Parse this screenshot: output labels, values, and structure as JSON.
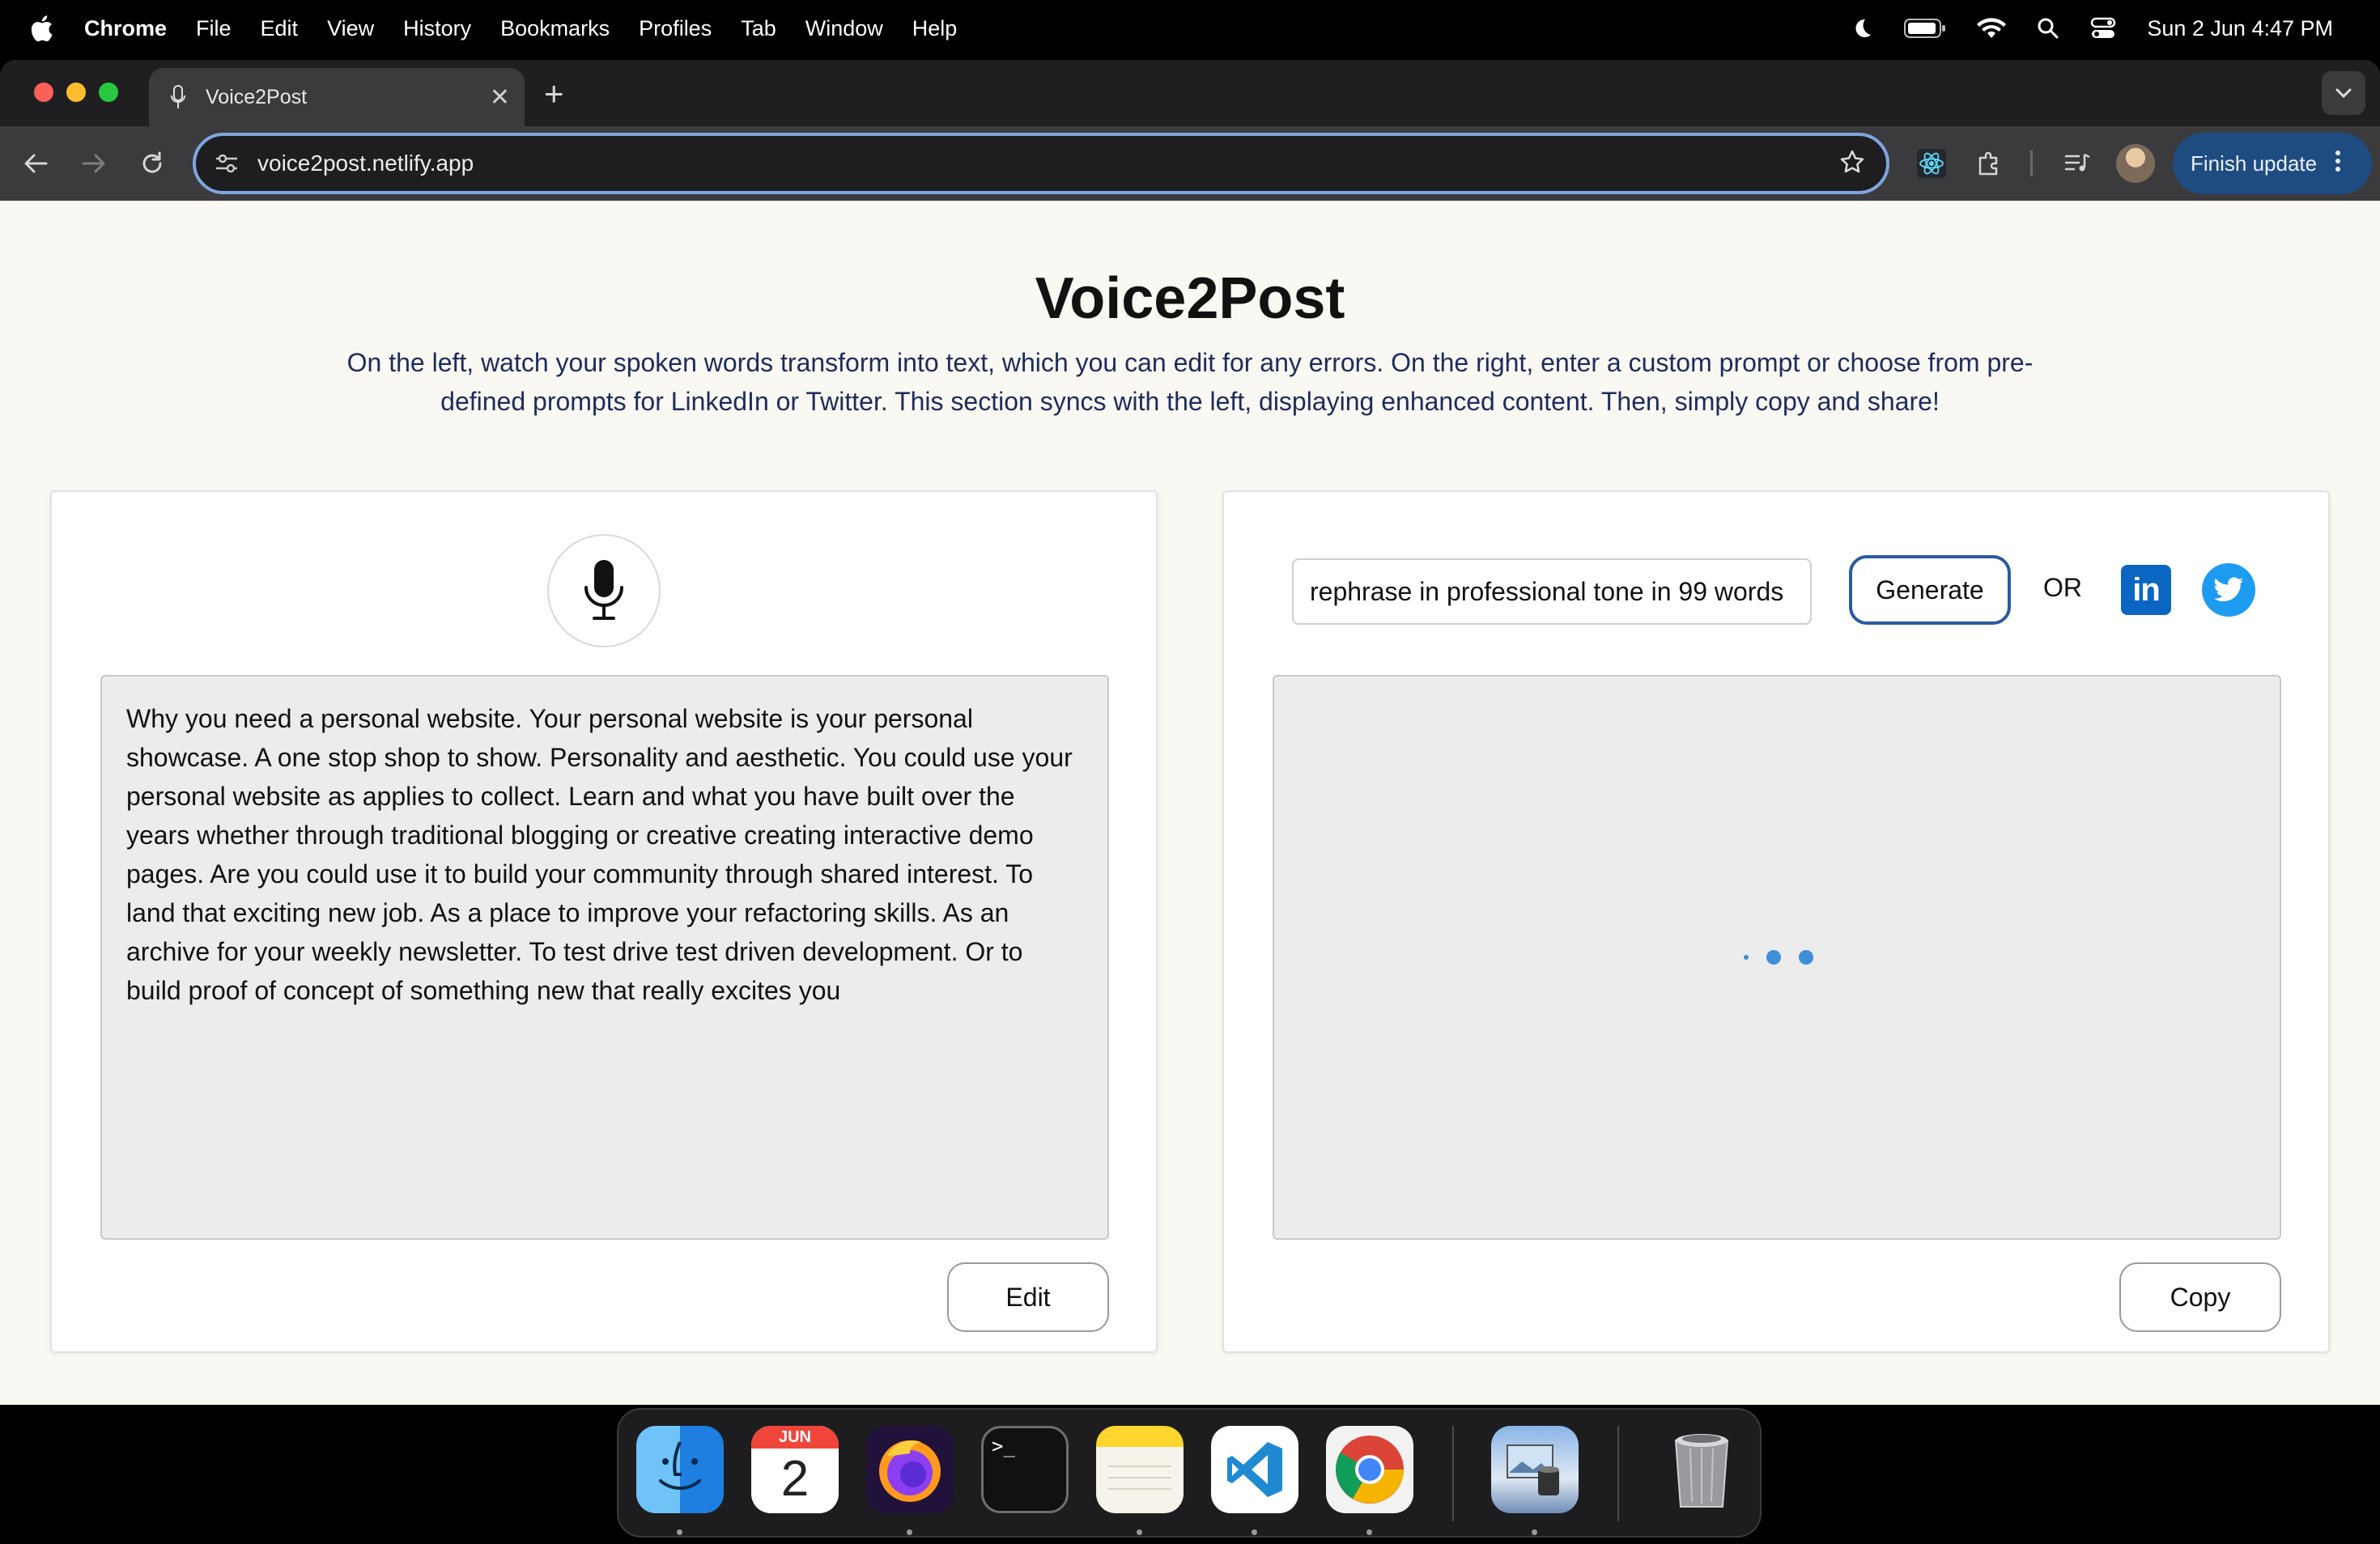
{
  "menubar": {
    "app_name": "Chrome",
    "menus": [
      "File",
      "Edit",
      "View",
      "History",
      "Bookmarks",
      "Profiles",
      "Tab",
      "Window",
      "Help"
    ],
    "clock": "Sun 2 Jun  4:47 PM"
  },
  "browser": {
    "tab_title": "Voice2Post",
    "url": "voice2post.netlify.app",
    "update_button": "Finish update"
  },
  "page": {
    "title": "Voice2Post",
    "subtitle": "On the left, watch your spoken words transform into text, which you can edit for any errors. On the right, enter a custom prompt or choose from pre-defined prompts for LinkedIn or Twitter. This section syncs with the left, displaying enhanced content. Then, simply copy and share!",
    "left": {
      "transcript": "Why you need a personal website. Your personal website is your personal showcase. A one stop shop to show. Personality and aesthetic. You could use your personal website as applies to collect. Learn and what you have built over the years whether through traditional blogging or creative creating interactive demo pages. Are you could use it to build your community through shared interest. To land that exciting new job. As a place to improve your refactoring skills. As an archive for your weekly newsletter. To test drive test driven development. Or to build proof of concept of something new that really excites you",
      "edit_label": "Edit"
    },
    "right": {
      "prompt_value": "rephrase in professional tone in 99 words",
      "generate_label": "Generate",
      "or_label": "OR",
      "linkedin_text": "in",
      "copy_label": "Copy"
    }
  },
  "dock": {
    "calendar_month": "JUN",
    "calendar_day": "2",
    "terminal_prompt": ">_"
  },
  "colors": {
    "accent": "#2c5aa0",
    "linkedin": "#0a66c2",
    "twitter": "#1d9bf0",
    "loader": "#3f8fd6",
    "subtitle": "#1d2c5b"
  }
}
